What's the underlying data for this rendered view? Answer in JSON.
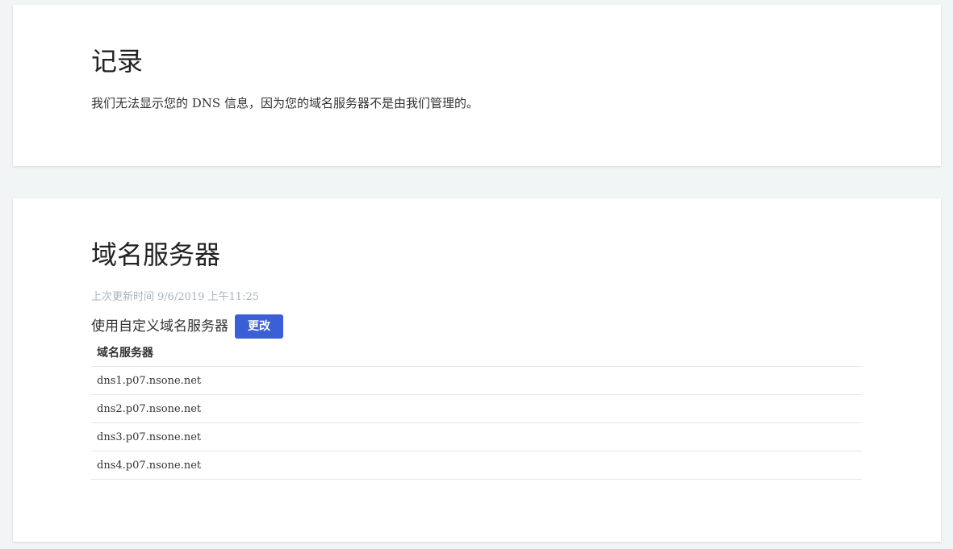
{
  "records": {
    "title": "记录",
    "description": "我们无法显示您的 DNS 信息，因为您的域名服务器不是由我们管理的。"
  },
  "nameservers": {
    "title": "域名服务器",
    "last_updated_label": "上次更新时间",
    "last_updated_value": "9/6/2019 上午11:25",
    "custom_label": "使用自定义域名服务器",
    "change_button": "更改",
    "table_header": "域名服务器",
    "rows": [
      "dns1.p07.nsone.net",
      "dns2.p07.nsone.net",
      "dns3.p07.nsone.net",
      "dns4.p07.nsone.net"
    ]
  },
  "colors": {
    "accent": "#3a5fd6",
    "background": "#f2f5f6",
    "muted_text": "#a8b4be"
  }
}
